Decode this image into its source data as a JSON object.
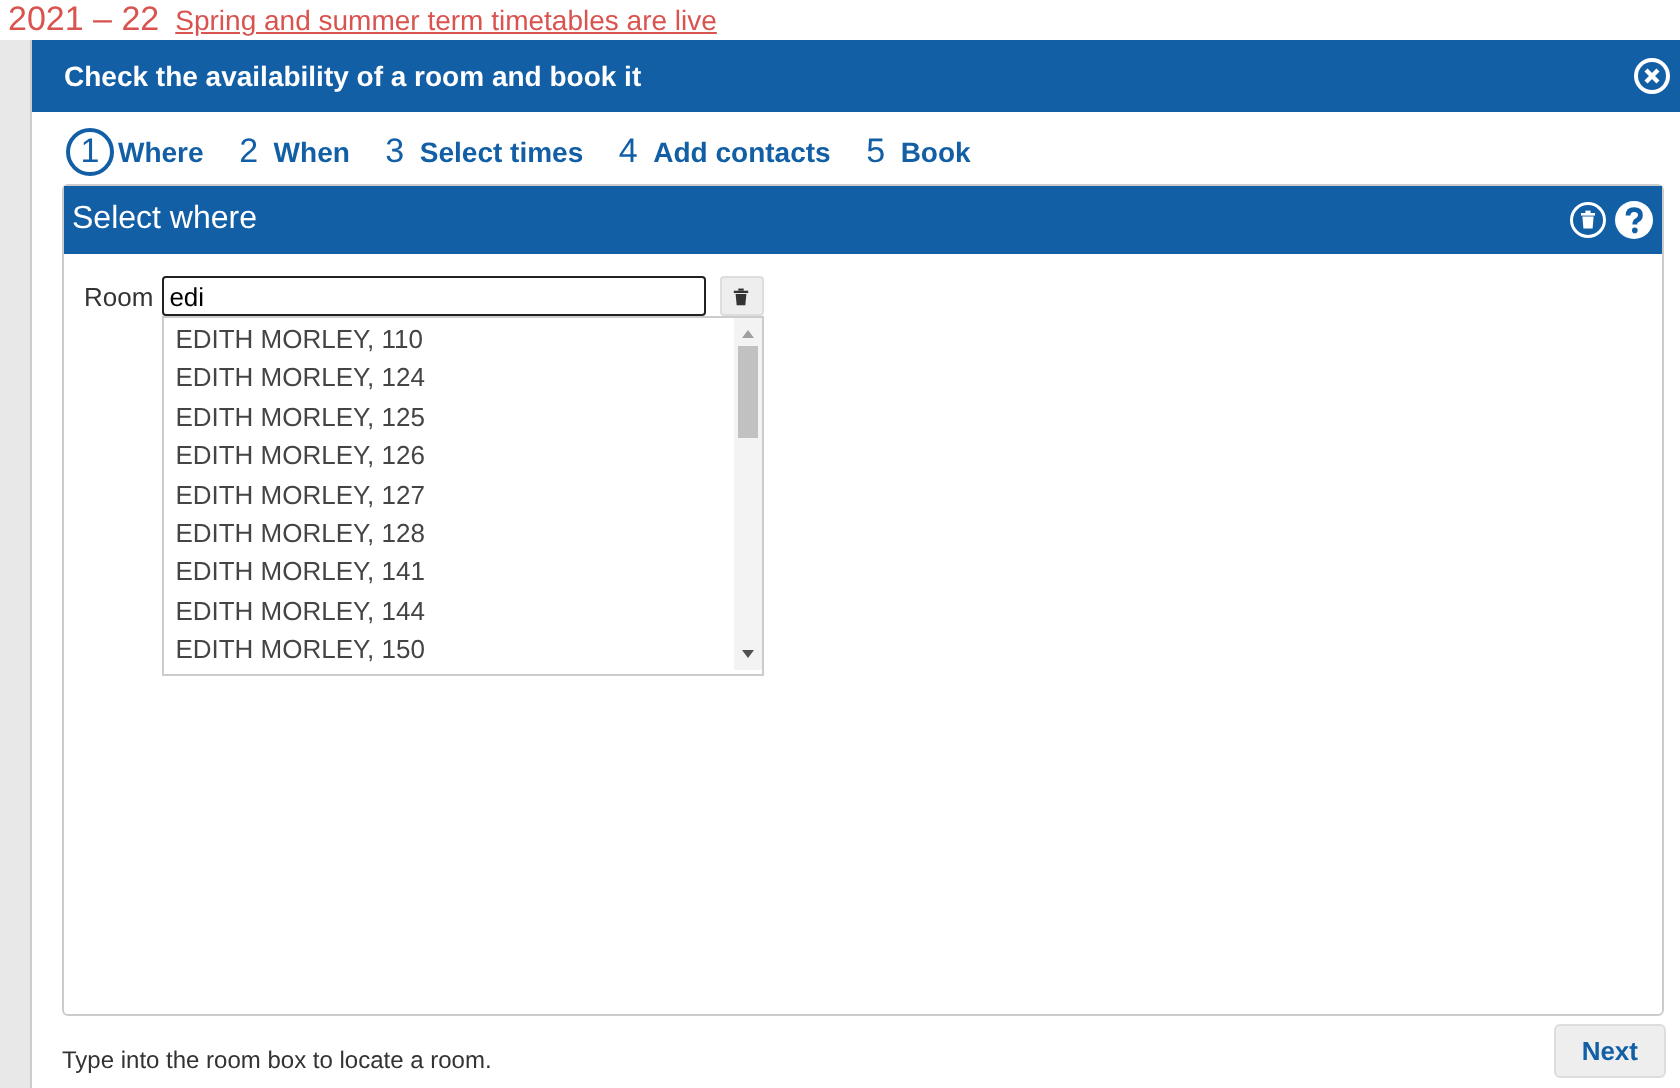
{
  "background": {
    "year": "2021 – 22",
    "notice": "Spring and summer term timetables are live"
  },
  "window": {
    "title": "Check the availability of a room and book it"
  },
  "steps": [
    {
      "number": "1",
      "label": "Where",
      "selected": true
    },
    {
      "number": "2",
      "label": "When",
      "selected": false
    },
    {
      "number": "3",
      "label": "Select times",
      "selected": false
    },
    {
      "number": "4",
      "label": "Add contacts",
      "selected": false
    },
    {
      "number": "5",
      "label": "Book",
      "selected": false
    }
  ],
  "panel": {
    "title": "Select where",
    "field_label": "Room",
    "value": "edi",
    "suggestions": [
      "EDITH MORLEY, 110",
      "EDITH MORLEY, 124",
      "EDITH MORLEY, 125",
      "EDITH MORLEY, 126",
      "EDITH MORLEY, 127",
      "EDITH MORLEY, 128",
      "EDITH MORLEY, 141",
      "EDITH MORLEY, 144",
      "EDITH MORLEY, 150"
    ]
  },
  "status_bar": {
    "hint": "Type into the room box to locate a room.",
    "button": "Next"
  }
}
